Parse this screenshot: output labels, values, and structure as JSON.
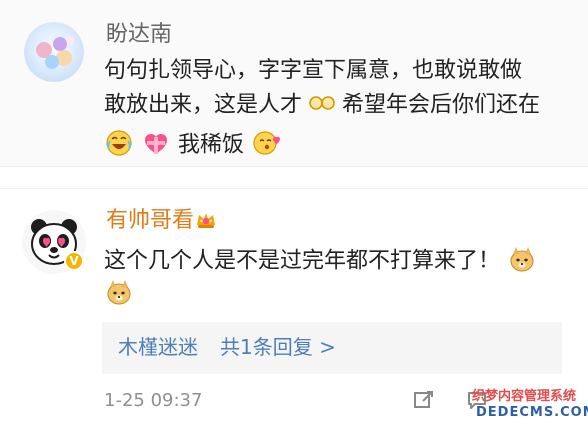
{
  "comments": [
    {
      "username": "盼达南",
      "lines": [
        "句句扎领导心，字字宣下属意，也敢说敢做",
        "敢放出来，这是人才",
        "希望年会后你们还在",
        "我稀饭"
      ],
      "colors": {
        "username": "#666666",
        "background": "#fafafa"
      },
      "icons": [
        "avatar-icon",
        "glasses-emoji-icon",
        "laughing-emoji-icon",
        "heart-gift-emoji-icon",
        "kiss-emoji-icon"
      ]
    },
    {
      "username": "有帅哥看",
      "text": "这个几个人是不是过完年都不打算来了！",
      "reply_preview": {
        "name": "木槿迷迷",
        "count_text": "共1条回复 >"
      },
      "timestamp": "1-25 09:37",
      "colors": {
        "username": "#e07b17",
        "reply_link": "#4d7fb8",
        "timestamp": "#8f8f8f"
      },
      "icons": [
        "panda-avatar-icon",
        "verified-badge-icon",
        "crown-emoji-icon",
        "doge-emoji-icon",
        "share-icon",
        "comment-icon"
      ]
    }
  ],
  "watermark": {
    "title": "织梦内容管理系统",
    "domain": "DEDECMS.COM"
  }
}
